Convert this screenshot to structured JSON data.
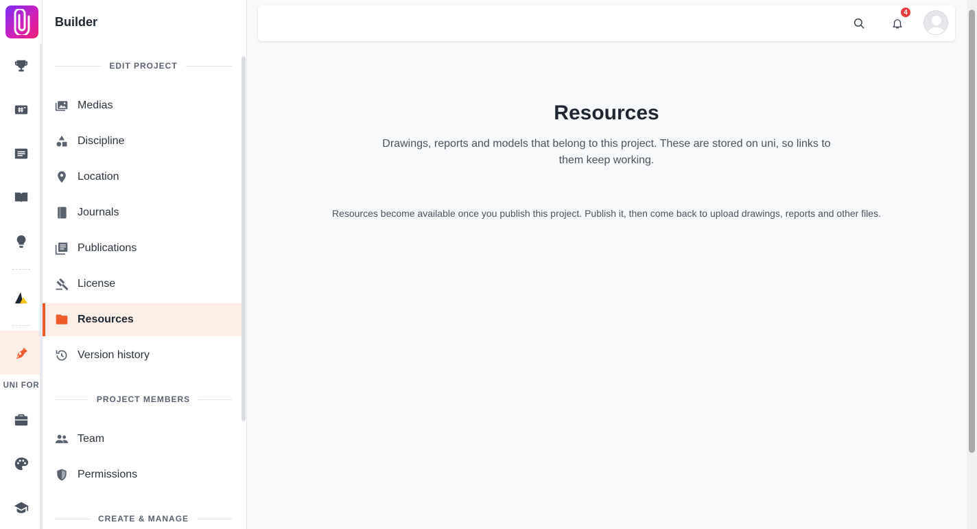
{
  "app": {
    "logo_icon": "paperclip-logo-icon",
    "accent_color": "#ef5a2b"
  },
  "rail": {
    "items": [
      {
        "name": "rail-competitions",
        "icon": "trophy-icon"
      },
      {
        "name": "rail-projects",
        "icon": "hashtag-board-icon"
      },
      {
        "name": "rail-posts",
        "icon": "news-icon"
      },
      {
        "name": "rail-library",
        "icon": "book-open-icon"
      },
      {
        "name": "rail-ideas",
        "icon": "lightbulb-icon"
      },
      {
        "name": "rail-brand",
        "icon": "triangle-logo-icon"
      },
      {
        "name": "rail-builder",
        "icon": "pen-nib-icon"
      },
      {
        "name": "rail-business",
        "icon": "briefcase-icon"
      },
      {
        "name": "rail-creators",
        "icon": "palette-icon"
      },
      {
        "name": "rail-education",
        "icon": "graduation-cap-icon"
      }
    ],
    "section_label": "UNI FOR"
  },
  "panel": {
    "title": "Builder",
    "sections": {
      "edit_project": "EDIT PROJECT",
      "project_members": "PROJECT MEMBERS",
      "create_manage": "CREATE & MANAGE"
    },
    "items": {
      "medias": "Medias",
      "discipline": "Discipline",
      "location": "Location",
      "journals": "Journals",
      "publications": "Publications",
      "license": "License",
      "resources": "Resources",
      "version_history": "Version history",
      "team": "Team",
      "permissions": "Permissions"
    }
  },
  "topbar": {
    "notifications_count": "4"
  },
  "main": {
    "title": "Resources",
    "description": "Drawings, reports and models that belong to this project. These are stored on uni, so links to them keep working.",
    "note": "Resources become available once you publish this project. Publish it, then come back to upload drawings, reports and other files."
  }
}
